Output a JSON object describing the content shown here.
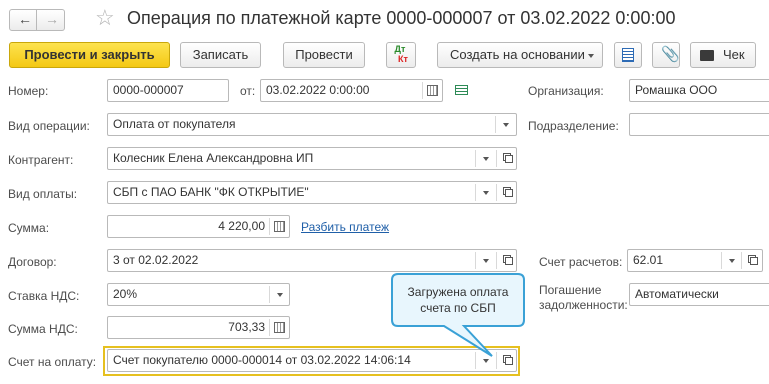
{
  "window": {
    "title": "Операция по платежной карте 0000-000007 от 03.02.2022 0:00:00"
  },
  "toolbar": {
    "post_close": "Провести и закрыть",
    "save": "Записать",
    "post": "Провести",
    "dtkt_top": "Дт",
    "dtkt_bottom": "Кт",
    "create_basis": "Создать на основании",
    "check": "Чек"
  },
  "form": {
    "number_label": "Номер:",
    "number_value": "0000-000007",
    "date_label": "от:",
    "date_value": "03.02.2022  0:00:00",
    "org_label": "Организация:",
    "org_value": "Ромашка ООО",
    "op_type_label": "Вид операции:",
    "op_type_value": "Оплата от покупателя",
    "subdivision_label": "Подразделение:",
    "subdivision_value": "",
    "counterparty_label": "Контрагент:",
    "counterparty_value": "Колесник Елена Александровна ИП",
    "payment_type_label": "Вид оплаты:",
    "payment_type_value": "СБП с ПАО БАНК \"ФК ОТКРЫТИЕ\"",
    "sum_label": "Сумма:",
    "sum_value": "4 220,00",
    "split_payment_link": "Разбить платеж",
    "contract_label": "Договор:",
    "contract_value": "3 от 02.02.2022",
    "account_label": "Счет расчетов:",
    "account_value": "62.01",
    "vat_rate_label": "Ставка НДС:",
    "vat_rate_value": "20%",
    "repayment_label_line1": "Погашение",
    "repayment_label_line2": "задолженности:",
    "repayment_value": "Автоматически",
    "vat_sum_label": "Сумма НДС:",
    "vat_sum_value": "703,33",
    "invoice_label": "Счет на оплату:",
    "invoice_value": "Счет покупателю 0000-000014 от 03.02.2022 14:06:14"
  },
  "callout": {
    "line1": "Загружена оплата",
    "line2": "счета по СБП"
  },
  "colors": {
    "primary_button": "#f4c814",
    "link": "#1f5fa8",
    "callout_border": "#3aa1d6",
    "callout_bg": "#e8f6fd",
    "highlight_border": "#e6c01f"
  }
}
